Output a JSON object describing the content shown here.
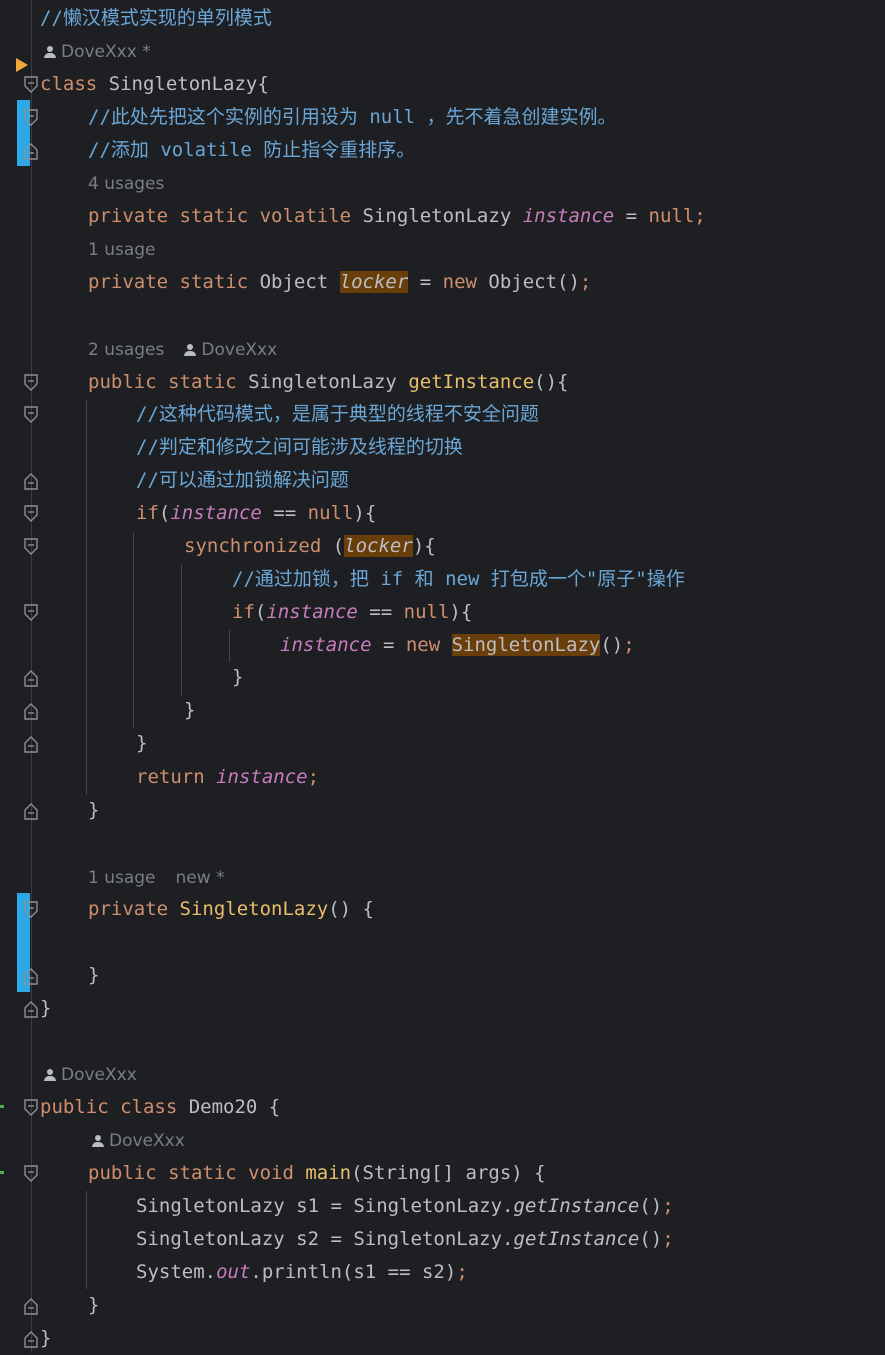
{
  "editor": {
    "lines": [
      {
        "id": "l1",
        "spans": [
          {
            "t": "//懒汉模式实现的单列模式",
            "c": "cmt"
          }
        ]
      },
      {
        "id": "l2",
        "hint": true,
        "author": "DoveXxx *"
      },
      {
        "id": "l3",
        "spans": [
          {
            "t": "class ",
            "c": "kw"
          },
          {
            "t": "SingletonLazy{",
            "c": ""
          }
        ]
      },
      {
        "id": "l4",
        "spans": [
          {
            "t": "//此处先把这个实例的引用设为 null ，先不着急创建实例。",
            "c": "cmt"
          }
        ]
      },
      {
        "id": "l5",
        "spans": [
          {
            "t": "//添加 volatile 防止指令重排序。",
            "c": "cmt"
          }
        ]
      },
      {
        "id": "l6",
        "hint": true,
        "usages": "4 usages"
      },
      {
        "id": "l7",
        "spans": [
          {
            "t": "private static volatile ",
            "c": "kw"
          },
          {
            "t": "SingletonLazy ",
            "c": ""
          },
          {
            "t": "instance",
            "c": "fld"
          },
          {
            "t": " = ",
            "c": ""
          },
          {
            "t": "null;",
            "c": "kw"
          }
        ]
      },
      {
        "id": "l8",
        "hint": true,
        "usages": "1 usage"
      },
      {
        "id": "l9",
        "spans": [
          {
            "t": "private static ",
            "c": "kw"
          },
          {
            "t": "Object ",
            "c": ""
          },
          {
            "t": "locker",
            "c": "ital hl"
          },
          {
            "t": " = ",
            "c": ""
          },
          {
            "t": "new ",
            "c": "kw"
          },
          {
            "t": "Object()",
            "c": ""
          },
          {
            "t": ";",
            "c": "kw"
          }
        ]
      },
      {
        "id": "l10",
        "hint": true,
        "usages": "2 usages",
        "author": "DoveXxx"
      },
      {
        "id": "l11",
        "spans": [
          {
            "t": "public static ",
            "c": "kw"
          },
          {
            "t": "SingletonLazy ",
            "c": ""
          },
          {
            "t": "getInstance",
            "c": "fn"
          },
          {
            "t": "(){",
            "c": ""
          }
        ]
      },
      {
        "id": "l12",
        "spans": [
          {
            "t": "//这种代码模式，是属于典型的线程不安全问题",
            "c": "cmt"
          }
        ]
      },
      {
        "id": "l13",
        "spans": [
          {
            "t": "//判定和修改之间可能涉及线程的切换",
            "c": "cmt"
          }
        ]
      },
      {
        "id": "l14",
        "spans": [
          {
            "t": "//可以通过加锁解决问题",
            "c": "cmt"
          }
        ]
      },
      {
        "id": "l15",
        "spans": [
          {
            "t": "if",
            "c": "kw"
          },
          {
            "t": "(",
            "c": ""
          },
          {
            "t": "instance",
            "c": "fld"
          },
          {
            "t": " == ",
            "c": ""
          },
          {
            "t": "null",
            "c": "kw"
          },
          {
            "t": "){",
            "c": ""
          }
        ]
      },
      {
        "id": "l16",
        "spans": [
          {
            "t": "synchronized ",
            "c": "kw"
          },
          {
            "t": "(",
            "c": ""
          },
          {
            "t": "locker",
            "c": "ital hl"
          },
          {
            "t": "){",
            "c": ""
          }
        ]
      },
      {
        "id": "l17",
        "spans": [
          {
            "t": "//通过加锁，把 if 和 new 打包成一个\"原子\"操作",
            "c": "cmt"
          }
        ]
      },
      {
        "id": "l18",
        "spans": [
          {
            "t": "if",
            "c": "kw"
          },
          {
            "t": "(",
            "c": ""
          },
          {
            "t": "instance",
            "c": "fld"
          },
          {
            "t": " == ",
            "c": ""
          },
          {
            "t": "null",
            "c": "kw"
          },
          {
            "t": "){",
            "c": ""
          }
        ]
      },
      {
        "id": "l19",
        "spans": [
          {
            "t": "instance",
            "c": "fld"
          },
          {
            "t": " = ",
            "c": ""
          },
          {
            "t": "new ",
            "c": "kw"
          },
          {
            "t": "SingletonLazy",
            "c": "hl"
          },
          {
            "t": "()",
            "c": ""
          },
          {
            "t": ";",
            "c": "kw"
          }
        ]
      },
      {
        "id": "l20",
        "spans": [
          {
            "t": "}",
            "c": ""
          }
        ]
      },
      {
        "id": "l21",
        "spans": [
          {
            "t": "}",
            "c": ""
          }
        ]
      },
      {
        "id": "l22",
        "spans": [
          {
            "t": "}",
            "c": ""
          }
        ]
      },
      {
        "id": "l23",
        "spans": [
          {
            "t": "return ",
            "c": "kw"
          },
          {
            "t": "instance",
            "c": "fld"
          },
          {
            "t": ";",
            "c": "kw"
          }
        ]
      },
      {
        "id": "l24",
        "spans": [
          {
            "t": "}",
            "c": ""
          }
        ]
      },
      {
        "id": "l25",
        "hint": true,
        "usages": "1 usage",
        "extra": "new *"
      },
      {
        "id": "l26",
        "spans": [
          {
            "t": "private ",
            "c": "kw"
          },
          {
            "t": "SingletonLazy",
            "c": "fn"
          },
          {
            "t": "() {",
            "c": ""
          }
        ]
      },
      {
        "id": "l27",
        "spans": [
          {
            "t": "}",
            "c": ""
          }
        ]
      },
      {
        "id": "l28",
        "spans": [
          {
            "t": "}",
            "c": ""
          }
        ]
      },
      {
        "id": "l29",
        "hint": true,
        "author": "DoveXxx"
      },
      {
        "id": "l30",
        "spans": [
          {
            "t": "public class ",
            "c": "kw"
          },
          {
            "t": "Demo20 {",
            "c": ""
          }
        ]
      },
      {
        "id": "l31",
        "hint": true,
        "author": "DoveXxx"
      },
      {
        "id": "l32",
        "spans": [
          {
            "t": "public static void ",
            "c": "kw"
          },
          {
            "t": "main",
            "c": "fn"
          },
          {
            "t": "(String[] args) {",
            "c": ""
          }
        ]
      },
      {
        "id": "l33",
        "spans": [
          {
            "t": "SingletonLazy s1 = SingletonLazy.",
            "c": ""
          },
          {
            "t": "getInstance",
            "c": "ital"
          },
          {
            "t": "()",
            "c": ""
          },
          {
            "t": ";",
            "c": "kw"
          }
        ]
      },
      {
        "id": "l34",
        "spans": [
          {
            "t": "SingletonLazy s2 = SingletonLazy.",
            "c": ""
          },
          {
            "t": "getInstance",
            "c": "ital"
          },
          {
            "t": "()",
            "c": ""
          },
          {
            "t": ";",
            "c": "kw"
          }
        ]
      },
      {
        "id": "l35",
        "spans": [
          {
            "t": "System.",
            "c": ""
          },
          {
            "t": "out",
            "c": "fld"
          },
          {
            "t": ".println(s1 == s2)",
            "c": ""
          },
          {
            "t": ";",
            "c": "kw"
          }
        ]
      },
      {
        "id": "l36",
        "spans": [
          {
            "t": "}",
            "c": ""
          }
        ]
      },
      {
        "id": "l37",
        "spans": [
          {
            "t": "}",
            "c": ""
          }
        ]
      }
    ]
  },
  "theme": {
    "background": "#1e1f22",
    "keyword": "#cf8e6d",
    "comment": "#6aa6d6",
    "method": "#e8be6a",
    "field": "#c77dbb",
    "highlight": "#6a3e0a",
    "vcs_change": "#2ea8e5",
    "run_marker": "#f0a73c"
  },
  "icons": [
    "run-arrow-icon",
    "fold-icon",
    "person-icon",
    "vcs-change-marker"
  ]
}
